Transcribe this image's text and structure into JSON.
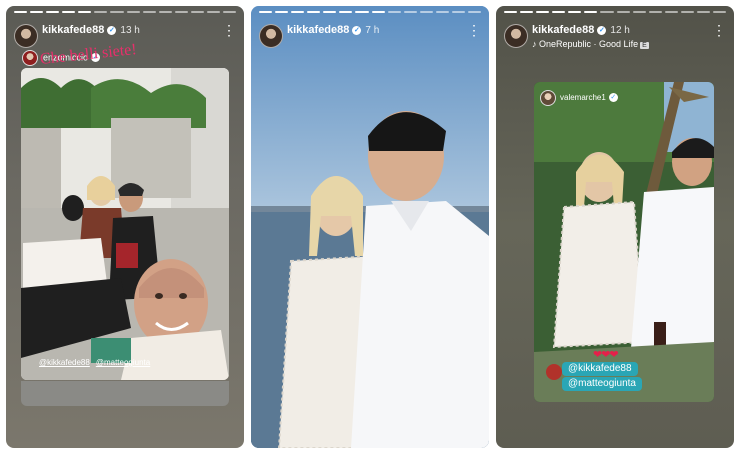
{
  "stories": [
    {
      "id": "s1",
      "username": "kikkafede88",
      "time": "13 h",
      "reshare_from": "enzomiccio",
      "caption": "Che belli siete!",
      "mentions": [
        "@kikkafede88",
        "@matteogiunta"
      ]
    },
    {
      "id": "s2",
      "username": "kikkafede88",
      "time": "7 h"
    },
    {
      "id": "s3",
      "username": "kikkafede88",
      "time": "12 h",
      "music": "OneRepublic · Good Life",
      "music_badge": "E",
      "reshare_from": "valemarche1",
      "hearts": "❤❤❤",
      "tags": [
        "@kikkafede88",
        "@matteogiunta"
      ]
    }
  ],
  "icons": {
    "verified": "verified-badge-icon",
    "more": "more-options-icon",
    "music": "music-note-icon"
  },
  "colors": {
    "caption_pink": "#e82f6b",
    "tag_bg": "#2aa6b5",
    "verified_blue": "#3897f0"
  }
}
